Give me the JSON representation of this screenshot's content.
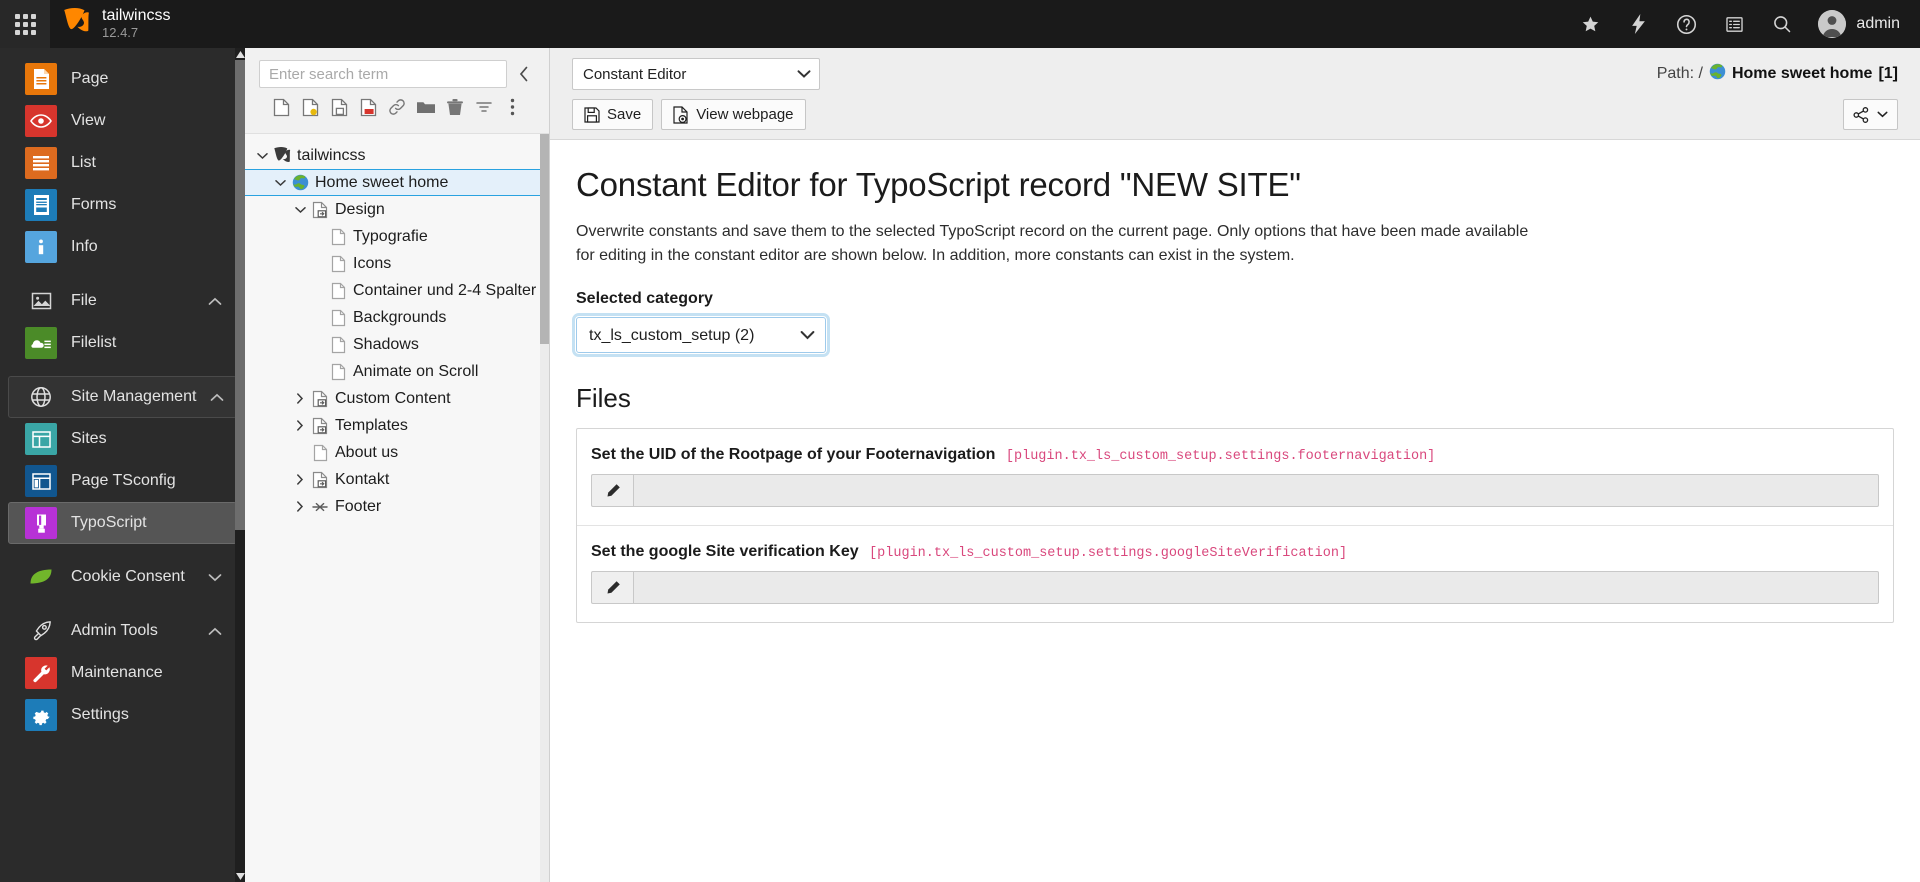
{
  "topbar": {
    "module_menu_icon": "grid-apps-icon",
    "logo_icon": "typo3-logo-icon",
    "site_title": "tailwincss",
    "version": "12.4.7",
    "tools": [
      {
        "name": "bookmarks-icon",
        "label": "Bookmarks"
      },
      {
        "name": "flash-icon",
        "label": "Flash"
      },
      {
        "name": "help-icon",
        "label": "Help"
      },
      {
        "name": "workspaces-icon",
        "label": "Workspaces"
      },
      {
        "name": "search-icon",
        "label": "Search"
      }
    ],
    "user": {
      "name": "admin",
      "avatar_icon": "user-avatar-icon"
    }
  },
  "modulemenu": {
    "items": [
      {
        "label": "Page",
        "icon": "page-icon",
        "type": "module",
        "color": "#e8770a",
        "state": ""
      },
      {
        "label": "View",
        "icon": "view-eye-icon",
        "type": "module",
        "color": "#d7352d",
        "state": ""
      },
      {
        "label": "List",
        "icon": "list-icon",
        "type": "module",
        "color": "#dd6b1f",
        "state": ""
      },
      {
        "label": "Forms",
        "icon": "forms-icon",
        "type": "module",
        "color": "#1d7cb8",
        "state": ""
      },
      {
        "label": "Info",
        "icon": "info-icon",
        "type": "module",
        "color": "#55a5de",
        "state": ""
      },
      {
        "label": "File",
        "icon": "file-image-icon",
        "type": "group",
        "color": "",
        "state": "expanded"
      },
      {
        "label": "Filelist",
        "icon": "filelist-icon",
        "type": "module",
        "color": "#4b8b28",
        "state": ""
      },
      {
        "label": "Site Management",
        "icon": "globe-icon",
        "type": "group",
        "color": "",
        "state": "expanded"
      },
      {
        "label": "Sites",
        "icon": "sites-icon",
        "type": "module",
        "color": "#3aa6a6",
        "state": ""
      },
      {
        "label": "Page TSconfig",
        "icon": "page-tsconfig-icon",
        "type": "module",
        "color": "#11568f",
        "state": ""
      },
      {
        "label": "TypoScript",
        "icon": "typoscript-icon",
        "type": "module",
        "color": "#b731d6",
        "state": "active"
      },
      {
        "label": "Cookie Consent",
        "icon": "leaf-icon",
        "type": "group",
        "color": "",
        "state": "collapsed"
      },
      {
        "label": "Admin Tools",
        "icon": "rocket-icon",
        "type": "group",
        "color": "",
        "state": "expanded"
      },
      {
        "label": "Maintenance",
        "icon": "wrench-icon",
        "type": "module",
        "color": "#d7352d",
        "state": ""
      },
      {
        "label": "Settings",
        "icon": "gear-icon",
        "type": "module",
        "color": "#1d7cb8",
        "state": ""
      }
    ]
  },
  "pagetree": {
    "search_placeholder": "Enter search term",
    "search_value": "",
    "collapse_icon": "chevron-left-icon",
    "toolbar": [
      {
        "name": "new-page-icon"
      },
      {
        "name": "new-page-wizard-icon"
      },
      {
        "name": "paste-page-icon"
      },
      {
        "name": "delete-page-icon"
      },
      {
        "name": "edit-link-icon"
      },
      {
        "name": "folder-icon"
      },
      {
        "name": "trash-icon"
      },
      {
        "name": "filter-icon"
      },
      {
        "name": "more-options-icon"
      }
    ],
    "nodes": [
      {
        "label": "tailwincss",
        "depth": 0,
        "icon": "typo3-root-icon",
        "toggle": "open",
        "selected": false
      },
      {
        "label": "Home sweet home",
        "depth": 1,
        "icon": "globe-page-icon",
        "toggle": "open",
        "selected": true
      },
      {
        "label": "Design",
        "depth": 2,
        "icon": "page-shortcut-icon",
        "toggle": "open",
        "selected": false
      },
      {
        "label": "Typografie",
        "depth": 3,
        "icon": "page-doc-icon",
        "toggle": "none",
        "selected": false
      },
      {
        "label": "Icons",
        "depth": 3,
        "icon": "page-doc-icon",
        "toggle": "none",
        "selected": false
      },
      {
        "label": "Container und 2-4 Spalter",
        "depth": 3,
        "icon": "page-doc-icon",
        "toggle": "none",
        "selected": false
      },
      {
        "label": "Backgrounds",
        "depth": 3,
        "icon": "page-doc-icon",
        "toggle": "none",
        "selected": false
      },
      {
        "label": "Shadows",
        "depth": 3,
        "icon": "page-doc-icon",
        "toggle": "none",
        "selected": false
      },
      {
        "label": "Animate on Scroll",
        "depth": 3,
        "icon": "page-doc-icon",
        "toggle": "none",
        "selected": false
      },
      {
        "label": "Custom Content",
        "depth": 2,
        "icon": "page-shortcut-icon",
        "toggle": "closed",
        "selected": false
      },
      {
        "label": "Templates",
        "depth": 2,
        "icon": "page-shortcut-icon",
        "toggle": "closed",
        "selected": false
      },
      {
        "label": "About us",
        "depth": 2,
        "icon": "page-doc-icon",
        "toggle": "none",
        "selected": false
      },
      {
        "label": "Kontakt",
        "depth": 2,
        "icon": "page-shortcut-icon",
        "toggle": "closed",
        "selected": false
      },
      {
        "label": "Footer",
        "depth": 2,
        "icon": "page-divider-icon",
        "toggle": "closed",
        "selected": false
      }
    ]
  },
  "docheader": {
    "module_select": "Constant Editor",
    "module_select_options": [
      "Constant Editor"
    ],
    "path_label": "Path: /",
    "path_page": "Home sweet home",
    "path_page_uid": "[1]",
    "path_page_icon": "globe-page-icon",
    "buttons": [
      {
        "label": "Save",
        "icon": "save-floppy-icon"
      },
      {
        "label": "View webpage",
        "icon": "view-webpage-icon"
      }
    ],
    "share_button": {
      "icon": "share-icon",
      "caret": "chevron-down-icon"
    }
  },
  "content": {
    "title": "Constant Editor for TypoScript record \"NEW SITE\"",
    "description": "Overwrite constants and save them to the selected TypoScript record on the current page. Only options that have been made available for editing in the constant editor are shown below. In addition, more constants can exist in the system.",
    "category_label": "Selected category",
    "category_value": "tx_ls_custom_setup (2)",
    "category_options": [
      "tx_ls_custom_setup (2)"
    ],
    "section_title": "Files",
    "constants": [
      {
        "title": "Set the UID of the Rootpage of your Footernavigation",
        "path": "[plugin.tx_ls_custom_setup.settings.footernavigation]",
        "value": "",
        "edit_icon": "pencil-icon"
      },
      {
        "title": "Set the google Site verification Key",
        "path": "[plugin.tx_ls_custom_setup.settings.googleSiteVerification]",
        "value": "",
        "edit_icon": "pencil-icon"
      }
    ]
  }
}
